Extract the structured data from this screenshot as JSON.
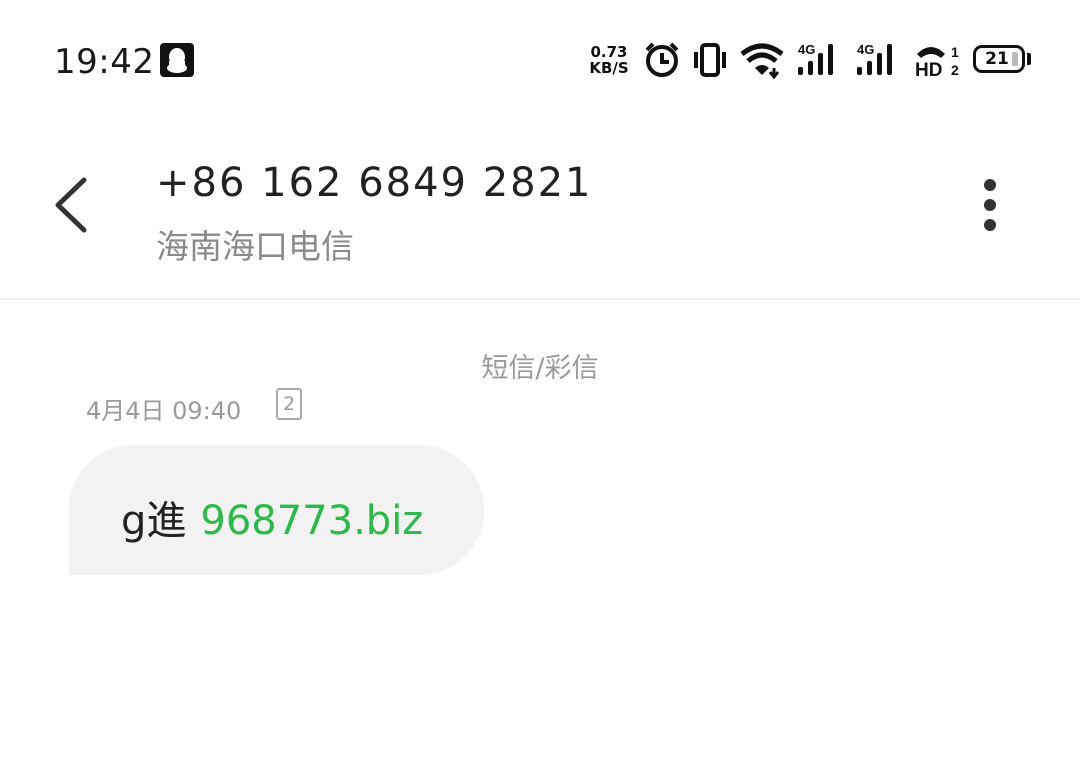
{
  "status_bar": {
    "time": "19:42",
    "net_speed_value": "0.73",
    "net_speed_unit": "KB/S",
    "battery": "21",
    "sim_indicator": "1",
    "sim_indicator_2": "2",
    "icons": [
      "qq-icon",
      "alarm-icon",
      "vibrate-icon",
      "wifi-icon",
      "signal-4g-icon",
      "signal-4g-icon",
      "hd-call-icon",
      "battery-icon"
    ],
    "network_labels": [
      "4G",
      "4G"
    ],
    "hd_label": "HD"
  },
  "header": {
    "phone_number": "+86 162 6849 2821",
    "location": "海南海口电信",
    "back_icon": "chevron-left-icon",
    "more_icon": "more-vertical-icon"
  },
  "conversation": {
    "message_type": "短信/彩信",
    "messages": [
      {
        "timestamp": "4月4日 09:40",
        "sim_slot": "2",
        "text_prefix": "g進",
        "link": "968773.biz",
        "link_color": "#2fb84a",
        "bubble_color": "#f2f2f2"
      }
    ]
  }
}
